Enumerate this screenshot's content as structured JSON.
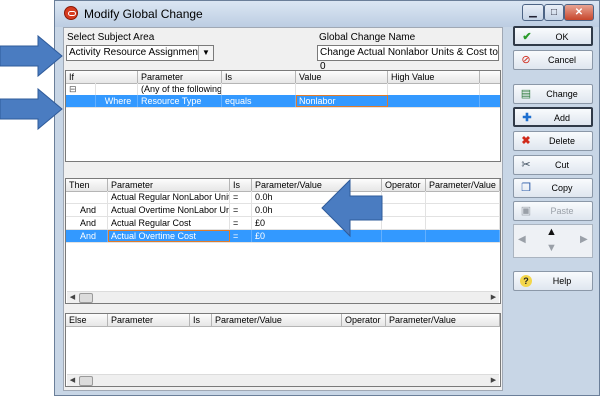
{
  "window": {
    "title": "Modify Global Change"
  },
  "subject": {
    "label": "Select Subject Area",
    "value": "Activity Resource Assignments"
  },
  "change_name": {
    "label": "Global Change Name",
    "value": "Change Actual Nonlabor Units & Cost to 0"
  },
  "if_grid": {
    "headers": [
      "If",
      "Parameter",
      "Is",
      "Value",
      "High Value"
    ],
    "rows": [
      {
        "col0": "⊟",
        "col1": "",
        "param": "(Any of the following)",
        "is": "",
        "value": ""
      },
      {
        "col0": "",
        "col1": "Where",
        "param": "Resource Type",
        "is": "equals",
        "value": "Nonlabor"
      }
    ]
  },
  "then_grid": {
    "headers": [
      "Then",
      "Parameter",
      "Is",
      "Parameter/Value",
      "Operator",
      "Parameter/Value"
    ],
    "rows": [
      {
        "then": "",
        "param": "Actual Regular NonLabor Units",
        "is": "=",
        "value": "0.0h"
      },
      {
        "then": "And",
        "param": "Actual Overtime NonLabor Units",
        "is": "=",
        "value": "0.0h"
      },
      {
        "then": "And",
        "param": "Actual Regular Cost",
        "is": "=",
        "value": "£0"
      },
      {
        "then": "And",
        "param": "Actual Overtime Cost",
        "is": "=",
        "value": "£0"
      }
    ]
  },
  "else_grid": {
    "headers": [
      "Else",
      "Parameter",
      "Is",
      "Parameter/Value",
      "Operator",
      "Parameter/Value"
    ]
  },
  "buttons": {
    "ok": {
      "label": "OK",
      "icon": "check-icon"
    },
    "cancel": {
      "label": "Cancel",
      "icon": "cancel-icon"
    },
    "change": {
      "label": "Change",
      "icon": "change-icon"
    },
    "add": {
      "label": "Add",
      "icon": "plus-icon"
    },
    "delete": {
      "label": "Delete",
      "icon": "delete-icon"
    },
    "cut": {
      "label": "Cut",
      "icon": "scissors-icon"
    },
    "copy": {
      "label": "Copy",
      "icon": "copy-icon"
    },
    "paste": {
      "label": "Paste",
      "icon": "paste-icon"
    },
    "help": {
      "label": "Help",
      "icon": "help-icon"
    }
  },
  "colors": {
    "selection": "#3399ff",
    "callout_arrow": "#4a7cc1",
    "focus": "#e07b2a"
  }
}
